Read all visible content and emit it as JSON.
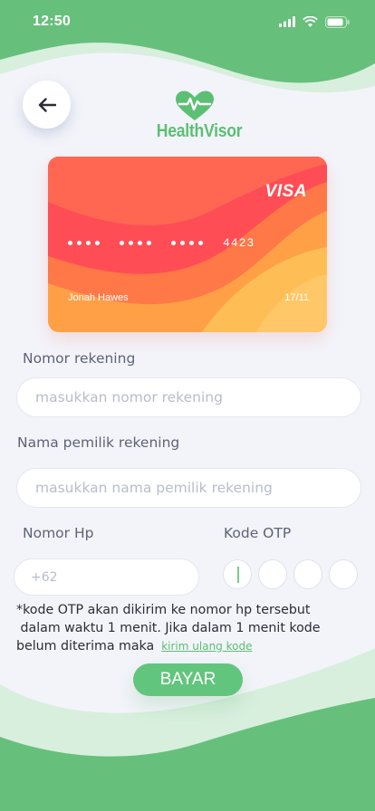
{
  "status_bar": {
    "time": "12:50"
  },
  "header": {
    "logo_text": "HealthVisor"
  },
  "card": {
    "brand": "VISA",
    "masked_groups": 3,
    "last4": "4423",
    "holder": "Jonah Hawes",
    "expiry": "17/11"
  },
  "form": {
    "account_number": {
      "label": "Nomor rekening",
      "placeholder": "masukkan nomor rekening"
    },
    "account_holder": {
      "label": "Nama pemilik rekening",
      "placeholder": "masukkan nama pemilik rekening"
    },
    "phone": {
      "label": "Nomor Hp",
      "placeholder": "+62"
    },
    "otp": {
      "label": "Kode OTP",
      "boxes": 4
    }
  },
  "note": {
    "line1": "*kode OTP akan dikirim ke nomor hp tersebut",
    "line2": " dalam waktu 1 menit. Jika dalam 1 menit kode",
    "line3": "belum diterima maka",
    "resend_link": "kirim ulang kode"
  },
  "pay_button": {
    "label": "BAYAR"
  },
  "colors": {
    "accent": "#62c57d",
    "card_primary": "#ff3f4f",
    "card_secondary": "#ffb24a",
    "background": "#f3f4fa"
  }
}
